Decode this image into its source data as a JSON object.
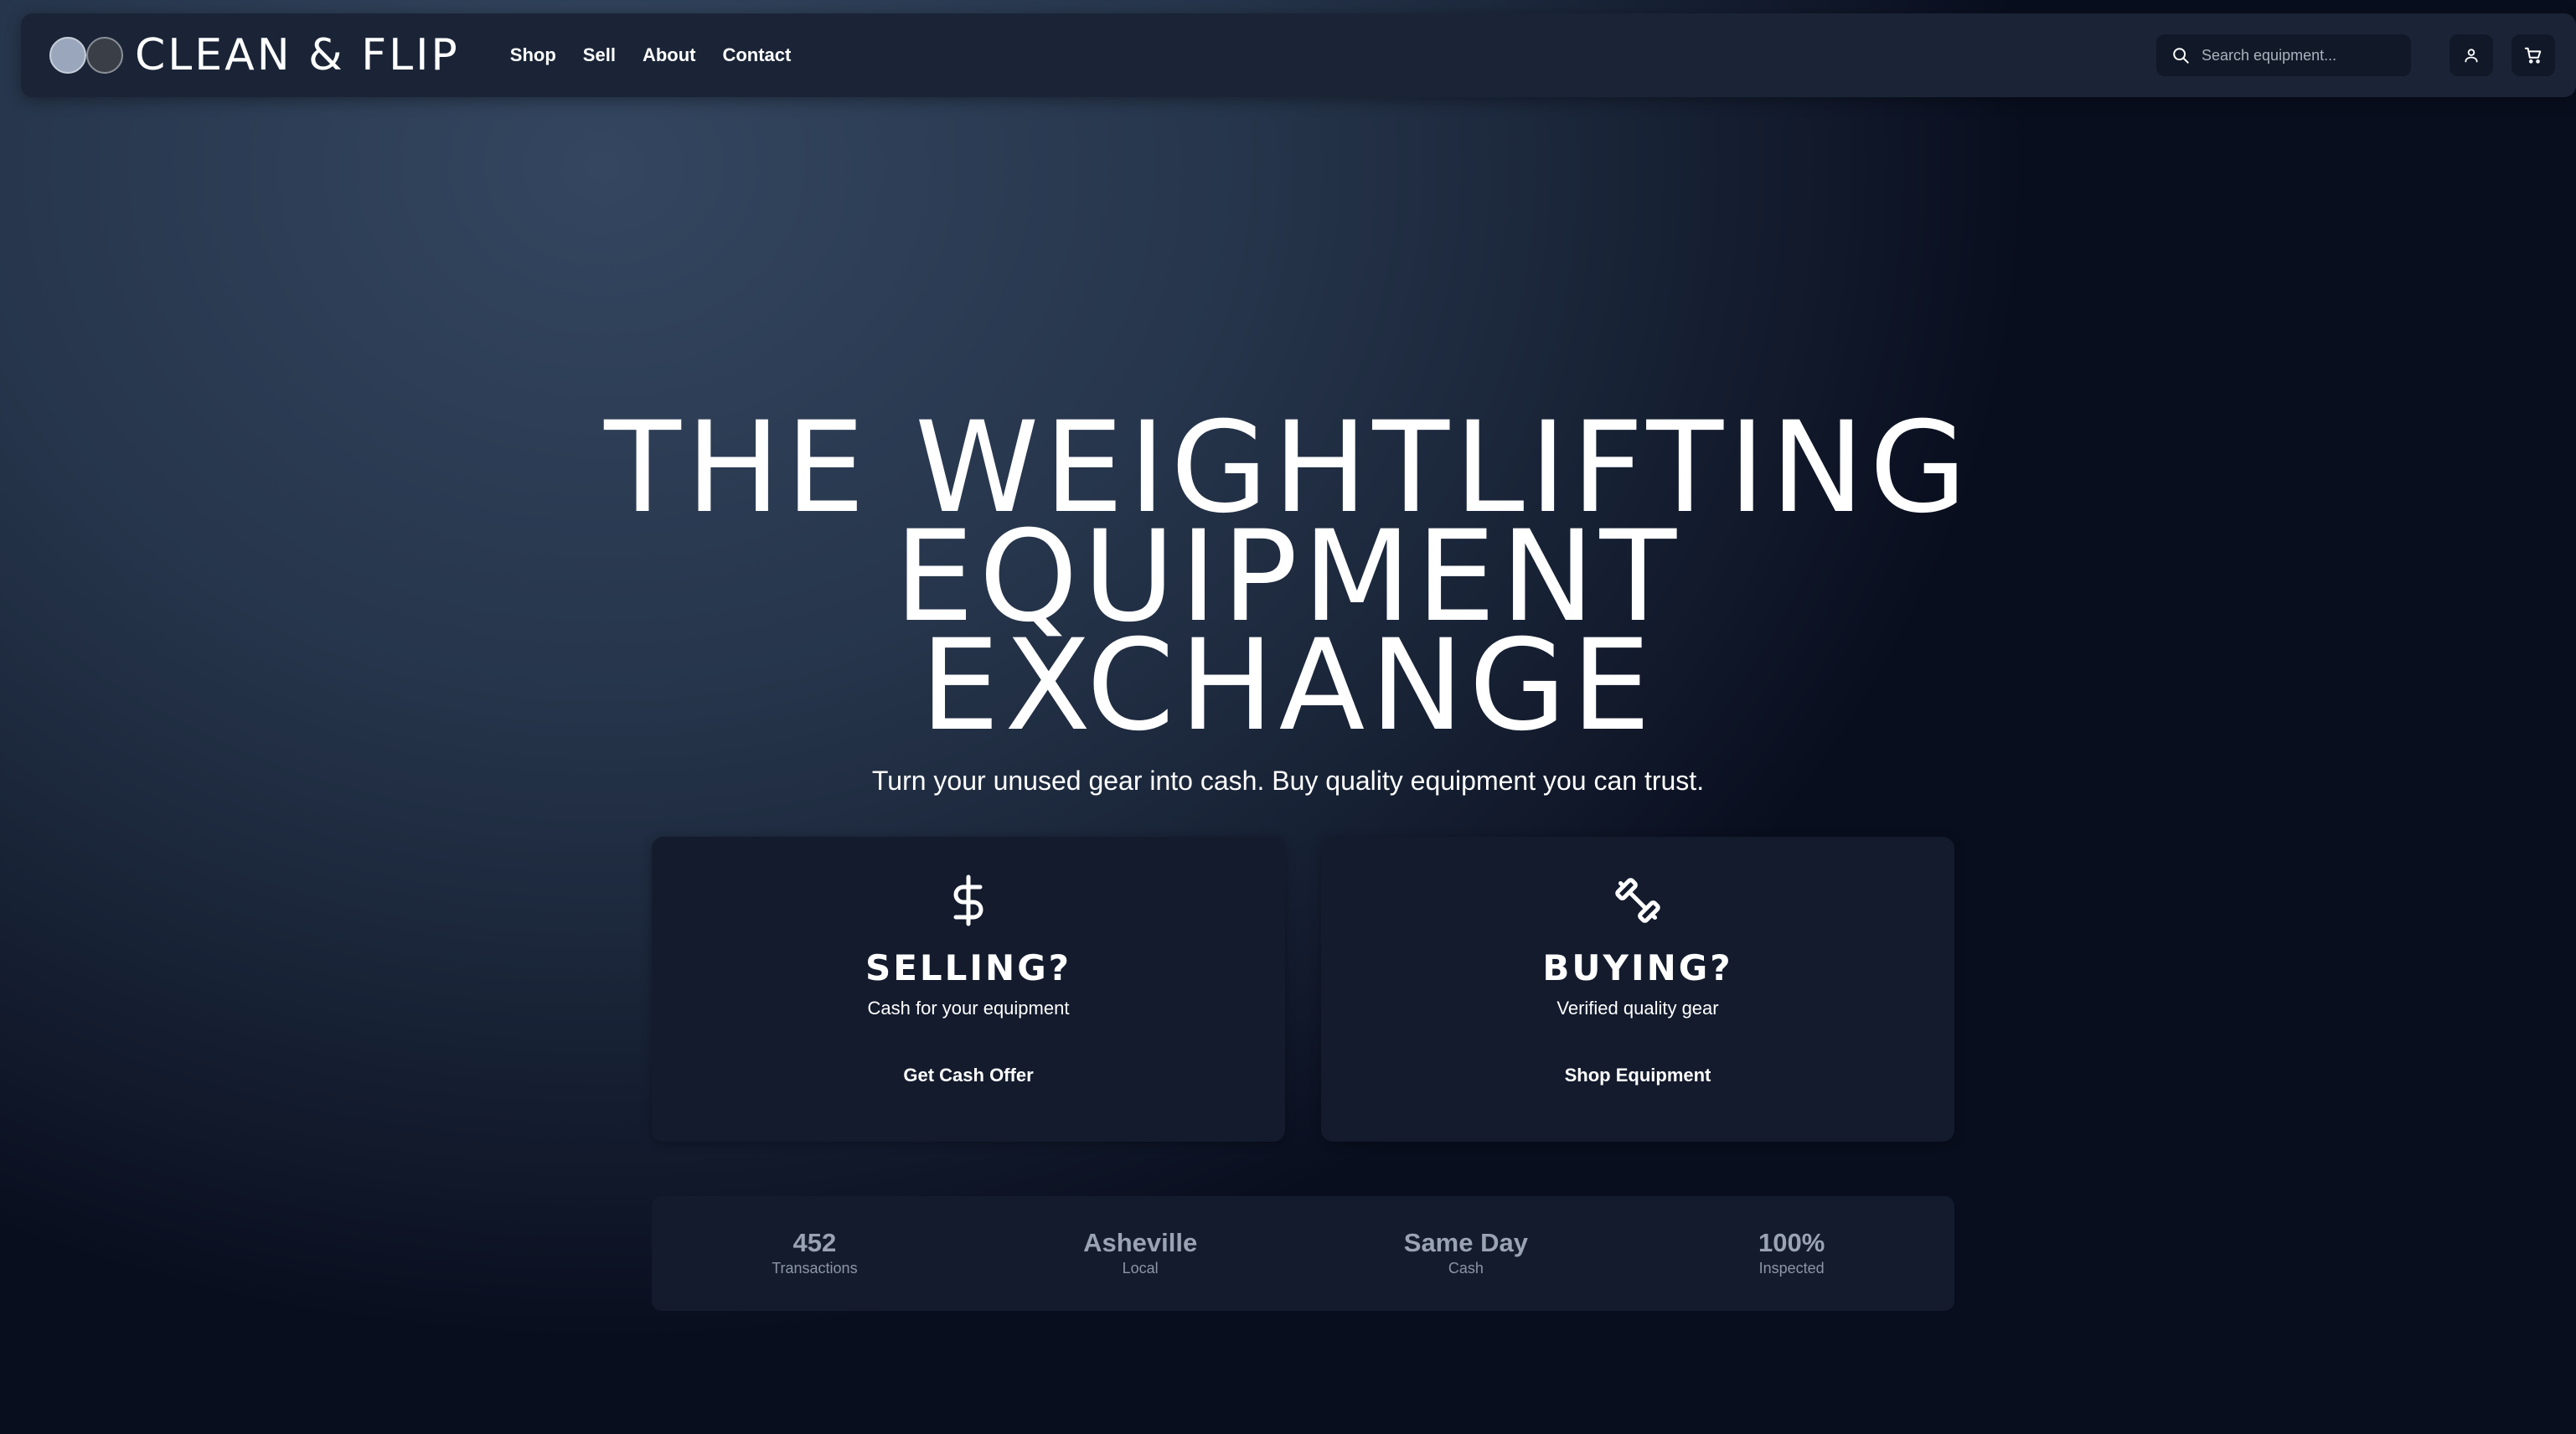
{
  "brand": {
    "name": "CLEAN & FLIP"
  },
  "nav": {
    "links": [
      {
        "label": "Shop"
      },
      {
        "label": "Sell"
      },
      {
        "label": "About"
      },
      {
        "label": "Contact"
      }
    ],
    "search_placeholder": "Search equipment...",
    "icons": [
      "search-icon",
      "user-icon",
      "cart-icon"
    ]
  },
  "hero": {
    "title_lines": [
      "THE WEIGHTLIFTING",
      "EQUIPMENT",
      "EXCHANGE"
    ],
    "subtitle": "Turn your unused gear into cash. Buy quality equipment you can trust."
  },
  "cards": [
    {
      "icon": "dollar-icon",
      "title": "SELLING?",
      "description": "Cash for your equipment",
      "button": "Get Cash Offer"
    },
    {
      "icon": "dumbbell-icon",
      "title": "BUYING?",
      "description": "Verified quality gear",
      "button": "Shop Equipment"
    }
  ],
  "stats": [
    {
      "value": "452",
      "label": "Transactions"
    },
    {
      "value": "Asheville",
      "label": "Local"
    },
    {
      "value": "Same Day",
      "label": "Cash"
    },
    {
      "value": "100%",
      "label": "Inspected"
    }
  ],
  "colors": {
    "background_light": "#344660",
    "background_dark": "#090e1e",
    "navbar": "#1a2436",
    "card": "#131b2d",
    "stat_text": "#9aa3b2"
  }
}
